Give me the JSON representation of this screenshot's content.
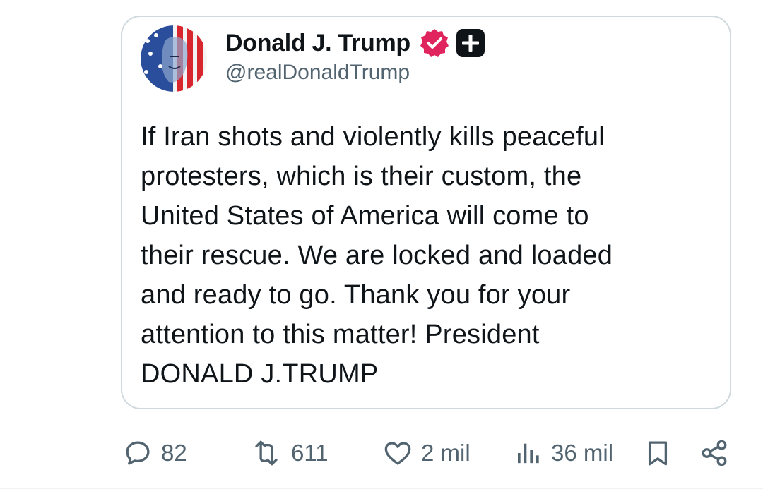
{
  "post": {
    "author": {
      "display_name": "Donald J. Trump",
      "handle": "@realDonaldTrump",
      "verified_color": "#e0245e"
    },
    "text": "If Iran shots and violently kills peaceful\nprotesters, which is their custom, the\nUnited States of America will come to\ntheir rescue. We are locked and loaded\nand ready to go. Thank you for your\nattention to this matter! President\nDONALD J.TRUMP"
  },
  "actions": {
    "replies": "82",
    "reposts": "611",
    "likes": "2 mil",
    "views": "36 mil"
  },
  "icons": [
    "verified-badge-icon",
    "plus-icon",
    "reply-icon",
    "repost-icon",
    "like-icon",
    "views-icon",
    "bookmark-icon",
    "share-icon"
  ],
  "colors": {
    "text_primary": "#0f1419",
    "text_secondary": "#536471",
    "border": "#cfd9de",
    "badge": "#e0245e"
  }
}
